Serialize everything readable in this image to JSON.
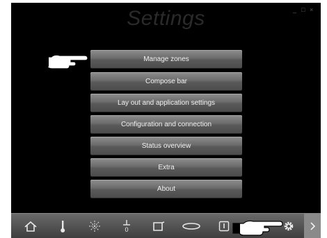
{
  "window": {
    "title": "Settings",
    "controls": {
      "minimize": "_",
      "maximize": "□",
      "close": "×"
    }
  },
  "menu": {
    "items": [
      {
        "label": "Manage zones"
      },
      {
        "label": "Compose bar"
      },
      {
        "label": "Lay out and application settings"
      },
      {
        "label": "Configuration and connection"
      },
      {
        "label": "Status overview"
      },
      {
        "label": "Extra"
      },
      {
        "label": "About"
      }
    ]
  },
  "toolbar": {
    "icons": [
      "home-icon",
      "thermometer-icon",
      "sun-icon",
      "fan-icon",
      "blind-icon",
      "light-icon",
      "device-icon",
      "gear-icon"
    ],
    "next_icon": "chevron-right-icon"
  },
  "colors": {
    "window_bg": "#000000",
    "button_gradient_top": "#8e8e8e",
    "button_gradient_bottom": "#4c4c4c",
    "toolbar_bg": "#555555"
  }
}
